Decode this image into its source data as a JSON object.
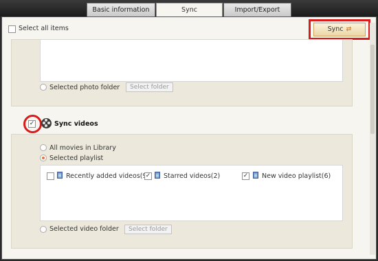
{
  "tabs": [
    {
      "label": "Basic information",
      "active": false
    },
    {
      "label": "Sync",
      "active": true
    },
    {
      "label": "Import/Export",
      "active": false
    }
  ],
  "header": {
    "select_all_label": "Select all items",
    "select_all_checked": false,
    "sync_button_label": "Sync",
    "sync_icon": "sync-arrows-icon"
  },
  "photos": {
    "selected_folder_label": "Selected photo folder",
    "select_folder_button": "Select folder"
  },
  "videos": {
    "section_title": "Sync videos",
    "section_checked": true,
    "options": [
      {
        "label": "All movies in Library",
        "selected": false
      },
      {
        "label": "Selected playlist",
        "selected": true
      }
    ],
    "playlists": [
      {
        "label": "Recently added videos(9)",
        "checked": false
      },
      {
        "label": "Starred videos(2)",
        "checked": true
      },
      {
        "label": "New video playlist(6)",
        "checked": true
      }
    ],
    "selected_folder_label": "Selected video folder",
    "select_folder_button": "Select folder"
  },
  "colors": {
    "highlight": "#d81b1b",
    "radio_selected": "#e8733a",
    "panel_bg": "#ece9dc",
    "window_bg": "#f6f5f0"
  }
}
